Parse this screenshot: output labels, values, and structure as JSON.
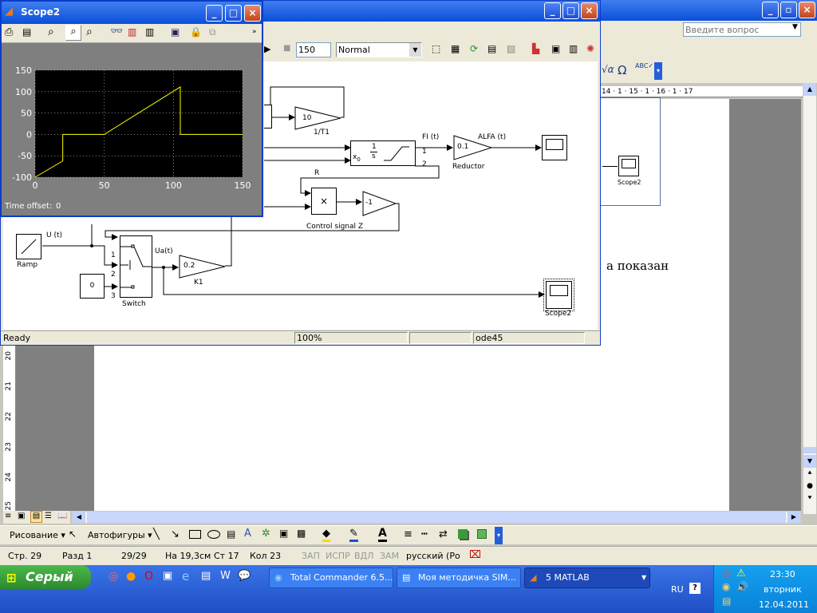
{
  "word": {
    "ask_question_placeholder": "Введите вопрос",
    "ruler": "14 · 1 · 15 · 1 · 16 · 1 · 17",
    "vruler": [
      "20",
      "21",
      "22",
      "23",
      "24",
      "25"
    ],
    "body_text": "а показан",
    "drawing_label": "Рисование ▾",
    "autoshapes_label": "Автофигуры ▾",
    "status": {
      "page": "Стр. 29",
      "section": "Разд 1",
      "pages": "29/29",
      "at": "На 19,3см",
      "line": "Ст 17",
      "col": "Кол 23",
      "rec": "ЗАП",
      "trk": "ИСПР",
      "ext": "ВДЛ",
      "ovr": "ЗАМ",
      "lang": "русский (Ро"
    }
  },
  "simulink": {
    "stop_time": "150",
    "mode": "Normal",
    "status_ready": "Ready",
    "zoom": "100%",
    "solver": "ode45",
    "blocks": {
      "gain_1t1": "10",
      "gain_1t1_label": "1/T1",
      "integ_num": "1",
      "integ_den": "s",
      "integ_x0": "x",
      "integ_sub": "0",
      "integ_out1": "1",
      "integ_out2": "2",
      "fi_label": "FI (t)",
      "reductor_gain": "0.1",
      "reductor_label": "Reductor",
      "alfa_label": "ALFA (t)",
      "r_label": "R",
      "product": "×",
      "neg_gain": "-1",
      "control_label": "Control signal Z",
      "ramp_label": "Ramp",
      "u_label": "U (t)",
      "ua_label": "Ua(t)",
      "switch_label": "Switch",
      "const_val": "0",
      "k1_val": "0.2",
      "k1_label": "K1",
      "scope2_label": "Scope2",
      "port1": "1",
      "port2": "2",
      "port3": "3"
    }
  },
  "scope": {
    "title": "Scope2",
    "time_offset_label": "Time offset:",
    "time_offset_value": "0"
  },
  "behind_scope2_label": "Scope2",
  "taskbar": {
    "start": "Серый",
    "tasks": [
      {
        "label": "Total Commander 6.5..."
      },
      {
        "label": "Моя методичка SIM..."
      },
      {
        "label": "5 MATLAB"
      }
    ],
    "lang": "RU",
    "time": "23:30",
    "day": "вторник",
    "date": "12.04.2011"
  },
  "chart_data": {
    "type": "line",
    "x": [
      0,
      20,
      20,
      50,
      105,
      105,
      150
    ],
    "y": [
      -100,
      -62,
      0,
      0,
      111,
      0,
      0
    ],
    "xlim": [
      0,
      150
    ],
    "ylim": [
      -100,
      150
    ],
    "xticks": [
      "0",
      "50",
      "100",
      "150"
    ],
    "yticks": [
      "150",
      "100",
      "50",
      "0",
      "-50",
      "-100"
    ],
    "grid": true,
    "line_color": "#ffff00",
    "background": "#000000"
  }
}
